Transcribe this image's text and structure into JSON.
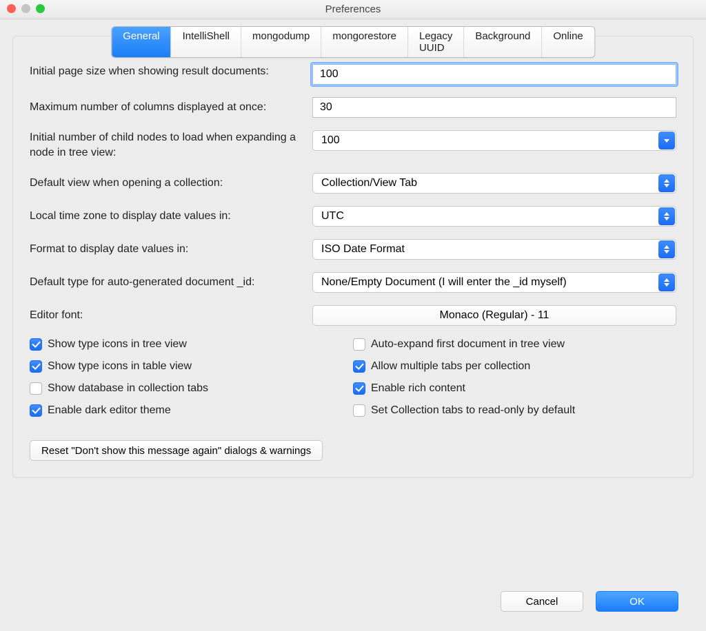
{
  "window": {
    "title": "Preferences"
  },
  "tabs": [
    "General",
    "IntelliShell",
    "mongodump",
    "mongorestore",
    "Legacy UUID",
    "Background",
    "Online"
  ],
  "labels": {
    "page_size": "Initial page size when showing result documents:",
    "max_cols": "Maximum number of columns displayed at once:",
    "child_nodes": "Initial number of child nodes to load when expanding a node in tree view:",
    "default_view": "Default view when opening a collection:",
    "tz": "Local time zone to display date values in:",
    "date_fmt": "Format to display date values in:",
    "id_type": "Default type for auto-generated document _id:",
    "font": "Editor font:"
  },
  "values": {
    "page_size": "100",
    "max_cols": "30",
    "child_nodes": "100",
    "default_view": "Collection/View Tab",
    "tz": "UTC",
    "date_fmt": "ISO Date Format",
    "id_type": "None/Empty Document (I will enter the _id myself)",
    "font": "Monaco (Regular) - 11"
  },
  "checks": {
    "left": [
      {
        "label": "Show type icons in tree view",
        "checked": true
      },
      {
        "label": "Show type icons in table view",
        "checked": true
      },
      {
        "label": "Show database in collection tabs",
        "checked": false
      },
      {
        "label": "Enable dark editor theme",
        "checked": true
      }
    ],
    "right": [
      {
        "label": "Auto-expand first document in tree view",
        "checked": false
      },
      {
        "label": "Allow multiple tabs per collection",
        "checked": true
      },
      {
        "label": "Enable rich content",
        "checked": true
      },
      {
        "label": "Set Collection tabs to read-only by default",
        "checked": false
      }
    ]
  },
  "buttons": {
    "reset": "Reset \"Don't show this message again\" dialogs & warnings",
    "cancel": "Cancel",
    "ok": "OK"
  }
}
